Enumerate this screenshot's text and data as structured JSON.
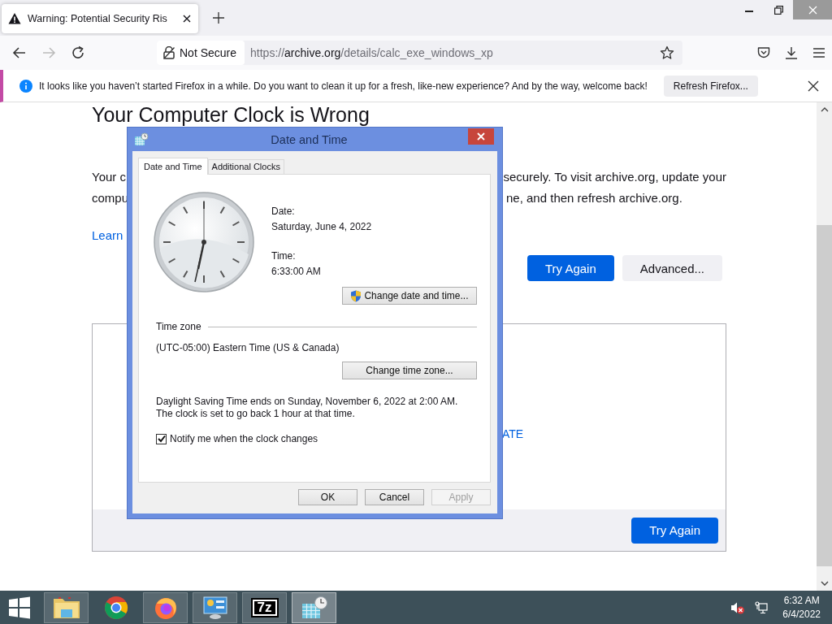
{
  "browser": {
    "tab": {
      "title": "Warning: Potential Security Ris",
      "selected": true
    },
    "security_label": "Not Secure",
    "url": {
      "scheme": "https://",
      "domain": "archive.org",
      "path": "/details/calc_exe_windows_xp"
    },
    "notification": {
      "message": "It looks like you haven’t started Firefox in a while. Do you want to clean it up for a fresh, like-new experience? And by the way, welcome back!",
      "button": "Refresh Firefox..."
    }
  },
  "page": {
    "heading": "Your Computer Clock is Wrong",
    "paragraph_lines": [
      {
        "left": "Your c",
        "right": "securely. To visit archive.org, update your"
      },
      {
        "left": "compu",
        "right": "ne, and then refresh archive.org."
      }
    ],
    "learn_link": "Learn",
    "buttons": [
      {
        "label": "Try Again",
        "kind": "primary"
      },
      {
        "label": "Advanced...",
        "kind": "secondary"
      }
    ],
    "box_link": "ATE",
    "box_button": "Try Again"
  },
  "dialog": {
    "title": "Date and Time",
    "tabs": [
      {
        "label": "Date and Time",
        "selected": true
      },
      {
        "label": "Additional Clocks",
        "selected": false
      }
    ],
    "date_label": "Date:",
    "date": "Saturday, June 4, 2022",
    "time_label": "Time:",
    "time": "6:33:00 AM",
    "change_date_button": "Change date and time...",
    "time_zone_heading": "Time zone",
    "time_zone": "(UTC-05:00) Eastern Time (US & Canada)",
    "change_zone_button": "Change time zone...",
    "dst_note": "Daylight Saving Time ends on Sunday, November 6, 2022 at 2:00 AM. The clock is set to go back 1 hour at that time.",
    "notify": {
      "label": "Notify me when the clock changes",
      "checked": true
    },
    "buttons": [
      {
        "label": "OK",
        "disabled": false
      },
      {
        "label": "Cancel",
        "disabled": false
      },
      {
        "label": "Apply",
        "disabled": true
      }
    ]
  },
  "taskbar": {
    "apps": [
      {
        "kind": "folder",
        "running": true,
        "selected": false
      },
      {
        "kind": "chrome",
        "running": false,
        "selected": false
      },
      {
        "kind": "firefox",
        "running": true,
        "selected": false
      },
      {
        "kind": "control-panel",
        "running": true,
        "selected": false
      },
      {
        "kind": "archiver",
        "glyph": "7z",
        "running": true,
        "selected": false
      },
      {
        "kind": "calendar-clock",
        "running": true,
        "selected": true
      }
    ],
    "clock_time": "6:32 AM",
    "clock_date": "6/4/2022"
  }
}
